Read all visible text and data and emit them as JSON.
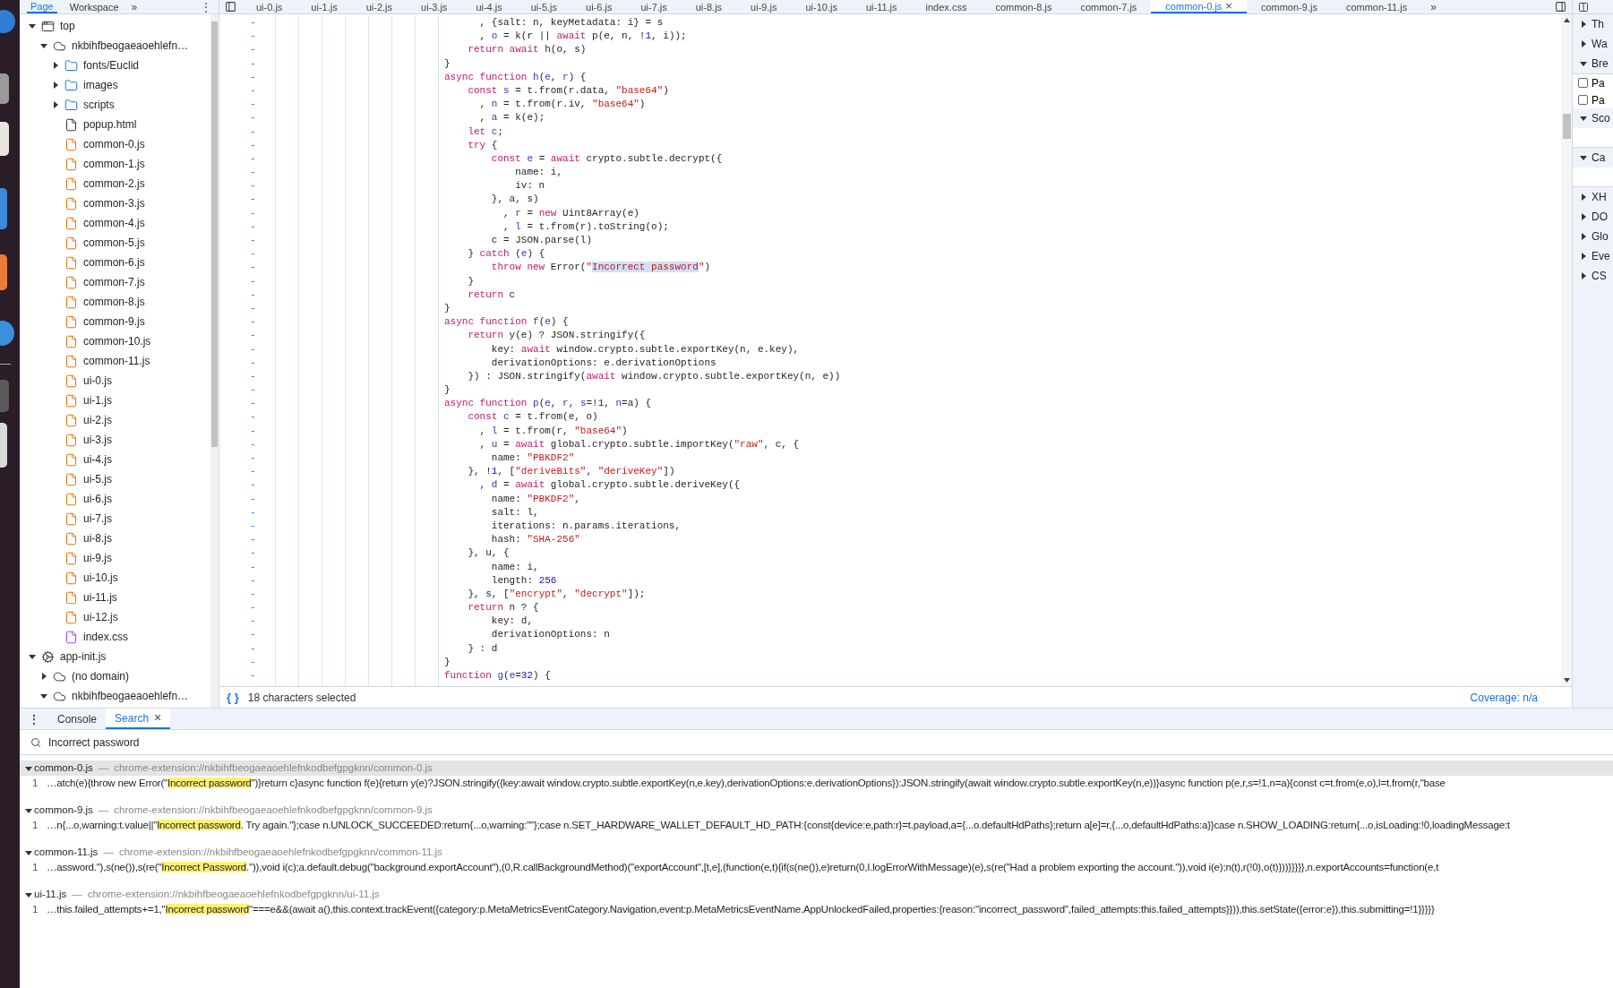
{
  "navigator_header": {
    "tabs": [
      {
        "label": "Page",
        "selected": true
      },
      {
        "label": "Workspace",
        "selected": false
      }
    ],
    "more": "»",
    "menu": "⋮"
  },
  "editor_tabs": {
    "tabs": [
      {
        "label": "ui-0.js",
        "selected": false
      },
      {
        "label": "ui-1.js",
        "selected": false
      },
      {
        "label": "ui-2.js",
        "selected": false
      },
      {
        "label": "ui-3.js",
        "selected": false
      },
      {
        "label": "ui-4.js",
        "selected": false
      },
      {
        "label": "ui-5.js",
        "selected": false
      },
      {
        "label": "ui-6.js",
        "selected": false
      },
      {
        "label": "ui-7.js",
        "selected": false
      },
      {
        "label": "ui-8.js",
        "selected": false
      },
      {
        "label": "ui-9.js",
        "selected": false
      },
      {
        "label": "ui-10.js",
        "selected": false
      },
      {
        "label": "ui-11.js",
        "selected": false
      },
      {
        "label": "index.css",
        "selected": false
      },
      {
        "label": "common-8.js",
        "selected": false
      },
      {
        "label": "common-7.js",
        "selected": false
      },
      {
        "label": "common-0.js",
        "selected": true,
        "close": "×"
      },
      {
        "label": "common-9.js",
        "selected": false
      },
      {
        "label": "common-11.js",
        "selected": false
      }
    ],
    "more": "»"
  },
  "navigator": {
    "tree": [
      {
        "label": "top",
        "kind": "frame",
        "expanded": true,
        "children": [
          {
            "label": "nkbihfbeogaeaoehlefn…",
            "kind": "cloud",
            "expanded": true,
            "children": [
              {
                "label": "fonts/Euclid",
                "kind": "folder",
                "expanded": false
              },
              {
                "label": "images",
                "kind": "folder",
                "expanded": false
              },
              {
                "label": "scripts",
                "kind": "folder",
                "expanded": false
              },
              {
                "label": "popup.html",
                "kind": "html"
              },
              {
                "label": "common-0.js",
                "kind": "js"
              },
              {
                "label": "common-1.js",
                "kind": "js"
              },
              {
                "label": "common-2.js",
                "kind": "js"
              },
              {
                "label": "common-3.js",
                "kind": "js"
              },
              {
                "label": "common-4.js",
                "kind": "js"
              },
              {
                "label": "common-5.js",
                "kind": "js"
              },
              {
                "label": "common-6.js",
                "kind": "js"
              },
              {
                "label": "common-7.js",
                "kind": "js"
              },
              {
                "label": "common-8.js",
                "kind": "js"
              },
              {
                "label": "common-9.js",
                "kind": "js"
              },
              {
                "label": "common-10.js",
                "kind": "js"
              },
              {
                "label": "common-11.js",
                "kind": "js"
              },
              {
                "label": "ui-0.js",
                "kind": "js"
              },
              {
                "label": "ui-1.js",
                "kind": "js"
              },
              {
                "label": "ui-2.js",
                "kind": "js"
              },
              {
                "label": "ui-3.js",
                "kind": "js"
              },
              {
                "label": "ui-4.js",
                "kind": "js"
              },
              {
                "label": "ui-5.js",
                "kind": "js"
              },
              {
                "label": "ui-6.js",
                "kind": "js"
              },
              {
                "label": "ui-7.js",
                "kind": "js"
              },
              {
                "label": "ui-8.js",
                "kind": "js"
              },
              {
                "label": "ui-9.js",
                "kind": "js"
              },
              {
                "label": "ui-10.js",
                "kind": "js"
              },
              {
                "label": "ui-11.js",
                "kind": "js"
              },
              {
                "label": "ui-12.js",
                "kind": "js"
              },
              {
                "label": "index.css",
                "kind": "css"
              }
            ]
          }
        ]
      },
      {
        "label": "app-init.js",
        "kind": "worker",
        "expanded": true,
        "children": [
          {
            "label": "(no domain)",
            "kind": "cloud",
            "expanded": false
          },
          {
            "label": "nkbihfbeogaeaoehlefn…",
            "kind": "cloud",
            "expanded": true
          }
        ]
      }
    ]
  },
  "editor": {
    "lines": [
      {
        "gutter": "-",
        "tokens": [
          {
            "text": "      , {salt: n, keyMetadata: i} = s",
            "kind": "plain"
          }
        ]
      },
      {
        "gutter": "-",
        "tokens": [
          {
            "text": "      , ",
            "kind": "plain"
          },
          {
            "text": "o",
            "kind": "def"
          },
          {
            "text": " = k(r || ",
            "kind": "plain"
          },
          {
            "text": "await",
            "kind": "keyword"
          },
          {
            "text": " p(e, n, !",
            "kind": "plain"
          },
          {
            "text": "1",
            "kind": "number"
          },
          {
            "text": ", i));",
            "kind": "plain"
          }
        ]
      },
      {
        "gutter": "-",
        "tokens": [
          {
            "text": "    return await",
            "kind": "keyword"
          },
          {
            "text": " h(o, s)",
            "kind": "plain"
          }
        ]
      },
      {
        "gutter": "-",
        "tokens": [
          {
            "text": "}",
            "kind": "plain"
          }
        ]
      },
      {
        "gutter": "-",
        "tokens": [
          {
            "text": "async function ",
            "kind": "keyword"
          },
          {
            "text": "h",
            "kind": "def"
          },
          {
            "text": "(",
            "kind": "plain"
          },
          {
            "text": "e",
            "kind": "def"
          },
          {
            "text": ", ",
            "kind": "plain"
          },
          {
            "text": "r",
            "kind": "def"
          },
          {
            "text": ") {",
            "kind": "plain"
          }
        ]
      },
      {
        "gutter": "-",
        "tokens": [
          {
            "text": "    const ",
            "kind": "keyword"
          },
          {
            "text": "s",
            "kind": "def"
          },
          {
            "text": " = t.from(r.data, ",
            "kind": "plain"
          },
          {
            "text": "\"base64\"",
            "kind": "string"
          },
          {
            "text": ")",
            "kind": "plain"
          }
        ]
      },
      {
        "gutter": "-",
        "tokens": [
          {
            "text": "      , ",
            "kind": "plain"
          },
          {
            "text": "n",
            "kind": "def"
          },
          {
            "text": " = t.from(r.iv, ",
            "kind": "plain"
          },
          {
            "text": "\"base64\"",
            "kind": "string"
          },
          {
            "text": ")",
            "kind": "plain"
          }
        ]
      },
      {
        "gutter": "-",
        "tokens": [
          {
            "text": "      , ",
            "kind": "plain"
          },
          {
            "text": "a",
            "kind": "def"
          },
          {
            "text": " = k(e);",
            "kind": "plain"
          }
        ]
      },
      {
        "gutter": "-",
        "tokens": [
          {
            "text": "    let ",
            "kind": "keyword"
          },
          {
            "text": "c",
            "kind": "def"
          },
          {
            "text": ";",
            "kind": "plain"
          }
        ]
      },
      {
        "gutter": "-",
        "tokens": [
          {
            "text": "    try",
            "kind": "keyword"
          },
          {
            "text": " {",
            "kind": "plain"
          }
        ]
      },
      {
        "gutter": "-",
        "tokens": [
          {
            "text": "        const ",
            "kind": "keyword"
          },
          {
            "text": "e",
            "kind": "def"
          },
          {
            "text": " = ",
            "kind": "plain"
          },
          {
            "text": "await",
            "kind": "keyword"
          },
          {
            "text": " crypto.subtle.decrypt({",
            "kind": "plain"
          }
        ]
      },
      {
        "gutter": "-",
        "tokens": [
          {
            "text": "            name: i,",
            "kind": "plain"
          }
        ]
      },
      {
        "gutter": "-",
        "tokens": [
          {
            "text": "            iv: n",
            "kind": "plain"
          }
        ]
      },
      {
        "gutter": "-",
        "tokens": [
          {
            "text": "        }, a, s)",
            "kind": "plain"
          }
        ]
      },
      {
        "gutter": "-",
        "tokens": [
          {
            "text": "          , ",
            "kind": "plain"
          },
          {
            "text": "r",
            "kind": "def"
          },
          {
            "text": " = ",
            "kind": "plain"
          },
          {
            "text": "new",
            "kind": "keyword"
          },
          {
            "text": " Uint8Array(e)",
            "kind": "plain"
          }
        ]
      },
      {
        "gutter": "-",
        "tokens": [
          {
            "text": "          , ",
            "kind": "plain"
          },
          {
            "text": "l",
            "kind": "def"
          },
          {
            "text": " = t.from(r).toString(o);",
            "kind": "plain"
          }
        ]
      },
      {
        "gutter": "-",
        "tokens": [
          {
            "text": "        c = JSON.parse(l)",
            "kind": "plain"
          }
        ]
      },
      {
        "gutter": "-",
        "tokens": [
          {
            "text": "    } ",
            "kind": "plain"
          },
          {
            "text": "catch",
            "kind": "keyword"
          },
          {
            "text": " (",
            "kind": "plain"
          },
          {
            "text": "e",
            "kind": "def"
          },
          {
            "text": ") {",
            "kind": "plain"
          }
        ]
      },
      {
        "gutter": "-",
        "tokens": [
          {
            "text": "        throw new",
            "kind": "keyword"
          },
          {
            "text": " Error(",
            "kind": "plain"
          },
          {
            "text": "\"",
            "kind": "string"
          },
          {
            "text": "Incorrect password",
            "kind": "selection"
          },
          {
            "text": "\"",
            "kind": "string"
          },
          {
            "text": ")",
            "kind": "plain"
          }
        ]
      },
      {
        "gutter": "-",
        "tokens": [
          {
            "text": "    }",
            "kind": "plain"
          }
        ]
      },
      {
        "gutter": "-",
        "tokens": [
          {
            "text": "    return",
            "kind": "keyword"
          },
          {
            "text": " c",
            "kind": "plain"
          }
        ]
      },
      {
        "gutter": "-",
        "tokens": [
          {
            "text": "}",
            "kind": "plain"
          }
        ]
      },
      {
        "gutter": "-",
        "tokens": [
          {
            "text": "async function ",
            "kind": "keyword"
          },
          {
            "text": "f",
            "kind": "def"
          },
          {
            "text": "(",
            "kind": "plain"
          },
          {
            "text": "e",
            "kind": "def"
          },
          {
            "text": ") {",
            "kind": "plain"
          }
        ]
      },
      {
        "gutter": "-",
        "tokens": [
          {
            "text": "    return",
            "kind": "keyword"
          },
          {
            "text": " y(e) ? JSON.stringify({",
            "kind": "plain"
          }
        ]
      },
      {
        "gutter": "-",
        "tokens": [
          {
            "text": "        key: ",
            "kind": "plain"
          },
          {
            "text": "await",
            "kind": "keyword"
          },
          {
            "text": " window.crypto.subtle.exportKey(n, e.key),",
            "kind": "plain"
          }
        ]
      },
      {
        "gutter": "-",
        "tokens": [
          {
            "text": "        derivationOptions: e.derivationOptions",
            "kind": "plain"
          }
        ]
      },
      {
        "gutter": "-",
        "tokens": [
          {
            "text": "    }) : JSON.stringify(",
            "kind": "plain"
          },
          {
            "text": "await",
            "kind": "keyword"
          },
          {
            "text": " window.crypto.subtle.exportKey(n, e))",
            "kind": "plain"
          }
        ]
      },
      {
        "gutter": "-",
        "tokens": [
          {
            "text": "}",
            "kind": "plain"
          }
        ]
      },
      {
        "gutter": "-",
        "tokens": [
          {
            "text": "async function ",
            "kind": "keyword"
          },
          {
            "text": "p",
            "kind": "def"
          },
          {
            "text": "(",
            "kind": "plain"
          },
          {
            "text": "e",
            "kind": "def"
          },
          {
            "text": ", ",
            "kind": "plain"
          },
          {
            "text": "r",
            "kind": "def"
          },
          {
            "text": ", ",
            "kind": "plain"
          },
          {
            "text": "s",
            "kind": "def"
          },
          {
            "text": "=!",
            "kind": "plain"
          },
          {
            "text": "1",
            "kind": "number"
          },
          {
            "text": ", ",
            "kind": "plain"
          },
          {
            "text": "n",
            "kind": "def"
          },
          {
            "text": "=a) {",
            "kind": "plain"
          }
        ]
      },
      {
        "gutter": "-",
        "tokens": [
          {
            "text": "    const ",
            "kind": "keyword"
          },
          {
            "text": "c",
            "kind": "def"
          },
          {
            "text": " = t.from(e, o)",
            "kind": "plain"
          }
        ]
      },
      {
        "gutter": "-",
        "tokens": [
          {
            "text": "      , ",
            "kind": "plain"
          },
          {
            "text": "l",
            "kind": "def"
          },
          {
            "text": " = t.from(r, ",
            "kind": "plain"
          },
          {
            "text": "\"base64\"",
            "kind": "string"
          },
          {
            "text": ")",
            "kind": "plain"
          }
        ]
      },
      {
        "gutter": "-",
        "tokens": [
          {
            "text": "      , ",
            "kind": "plain"
          },
          {
            "text": "u",
            "kind": "def"
          },
          {
            "text": " = ",
            "kind": "plain"
          },
          {
            "text": "await",
            "kind": "keyword"
          },
          {
            "text": " global.crypto.subtle.importKey(",
            "kind": "plain"
          },
          {
            "text": "\"raw\"",
            "kind": "string"
          },
          {
            "text": ", c, {",
            "kind": "plain"
          }
        ]
      },
      {
        "gutter": "-",
        "tokens": [
          {
            "text": "        name: ",
            "kind": "plain"
          },
          {
            "text": "\"PBKDF2\"",
            "kind": "string"
          }
        ]
      },
      {
        "gutter": "-",
        "tokens": [
          {
            "text": "    }, !",
            "kind": "plain"
          },
          {
            "text": "1",
            "kind": "number"
          },
          {
            "text": ", [",
            "kind": "plain"
          },
          {
            "text": "\"deriveBits\"",
            "kind": "string"
          },
          {
            "text": ", ",
            "kind": "plain"
          },
          {
            "text": "\"deriveKey\"",
            "kind": "string"
          },
          {
            "text": "])",
            "kind": "plain"
          }
        ]
      },
      {
        "gutter": "-",
        "tokens": [
          {
            "text": "      , ",
            "kind": "plain"
          },
          {
            "text": "d",
            "kind": "def"
          },
          {
            "text": " = ",
            "kind": "plain"
          },
          {
            "text": "await",
            "kind": "keyword"
          },
          {
            "text": " global.crypto.subtle.deriveKey({",
            "kind": "plain"
          }
        ]
      },
      {
        "gutter": "-",
        "tokens": [
          {
            "text": "        name: ",
            "kind": "plain"
          },
          {
            "text": "\"PBKDF2\"",
            "kind": "string"
          },
          {
            "text": ",",
            "kind": "plain"
          }
        ]
      },
      {
        "gutter": "-",
        "tokens": [
          {
            "text": "        salt: l,",
            "kind": "plain"
          }
        ]
      },
      {
        "gutter": "-",
        "tokens": [
          {
            "text": "        iterations: n.params.iterations,",
            "kind": "plain"
          }
        ]
      },
      {
        "gutter": "-",
        "tokens": [
          {
            "text": "        hash: ",
            "kind": "plain"
          },
          {
            "text": "\"SHA-256\"",
            "kind": "string"
          }
        ]
      },
      {
        "gutter": "-",
        "tokens": [
          {
            "text": "    }, u, {",
            "kind": "plain"
          }
        ]
      },
      {
        "gutter": "-",
        "tokens": [
          {
            "text": "        name: i,",
            "kind": "plain"
          }
        ]
      },
      {
        "gutter": "-",
        "tokens": [
          {
            "text": "        length: ",
            "kind": "plain"
          },
          {
            "text": "256",
            "kind": "number"
          }
        ]
      },
      {
        "gutter": "-",
        "tokens": [
          {
            "text": "    }, s, [",
            "kind": "plain"
          },
          {
            "text": "\"encrypt\"",
            "kind": "string"
          },
          {
            "text": ", ",
            "kind": "plain"
          },
          {
            "text": "\"decrypt\"",
            "kind": "string"
          },
          {
            "text": "]);",
            "kind": "plain"
          }
        ]
      },
      {
        "gutter": "-",
        "tokens": [
          {
            "text": "    return",
            "kind": "keyword"
          },
          {
            "text": " n ? {",
            "kind": "plain"
          }
        ]
      },
      {
        "gutter": "-",
        "tokens": [
          {
            "text": "        key: d,",
            "kind": "plain"
          }
        ]
      },
      {
        "gutter": "-",
        "tokens": [
          {
            "text": "        derivationOptions: n",
            "kind": "plain"
          }
        ]
      },
      {
        "gutter": "-",
        "tokens": [
          {
            "text": "    } : d",
            "kind": "plain"
          }
        ]
      },
      {
        "gutter": "-",
        "tokens": [
          {
            "text": "}",
            "kind": "plain"
          }
        ]
      },
      {
        "gutter": "-",
        "tokens": [
          {
            "text": "function ",
            "kind": "keyword"
          },
          {
            "text": "g",
            "kind": "def"
          },
          {
            "text": "(",
            "kind": "plain"
          },
          {
            "text": "e",
            "kind": "def"
          },
          {
            "text": "=",
            "kind": "plain"
          },
          {
            "text": "32",
            "kind": "number"
          },
          {
            "text": ") {",
            "kind": "plain"
          }
        ]
      }
    ]
  },
  "status_bar": {
    "format_button": "{ }",
    "selection": "18 characters selected",
    "coverage": "Coverage: n/a"
  },
  "right_panel": {
    "items": [
      {
        "kind": "section",
        "label": "Th",
        "expanded": false
      },
      {
        "kind": "section",
        "label": "Wa",
        "expanded": false
      },
      {
        "kind": "section",
        "label": "Bre",
        "expanded": true
      },
      {
        "kind": "checkbox",
        "label": "Pa",
        "checked": false
      },
      {
        "kind": "checkbox",
        "label": "Pa",
        "checked": false
      },
      {
        "kind": "section",
        "label": "Sco",
        "expanded": true
      },
      {
        "kind": "section",
        "label": "Ca",
        "expanded": true
      },
      {
        "kind": "section",
        "label": "XH",
        "expanded": false
      },
      {
        "kind": "section",
        "label": "DO",
        "expanded": false
      },
      {
        "kind": "section",
        "label": "Glo",
        "expanded": false
      },
      {
        "kind": "section",
        "label": "Eve",
        "expanded": false
      },
      {
        "kind": "section",
        "label": "CS",
        "expanded": false
      }
    ]
  },
  "drawer": {
    "menu": "⋮",
    "tabs": [
      {
        "label": "Console",
        "selected": false
      },
      {
        "label": "Search",
        "selected": true,
        "close": "×"
      }
    ],
    "search": {
      "value": "Incorrect password"
    },
    "results": [
      {
        "file": "common-0.js",
        "separator": "—",
        "url": "chrome-extension://nkbihfbeogaeaoehlefnkodbefgpgknn/common-0.js",
        "expanded": true,
        "selected": true,
        "matches": [
          {
            "line": "1",
            "before": "…atch(e){throw new Error(\"",
            "match": "Incorrect password",
            "after": "\")}return c}async function f(e){return y(e)?JSON.stringify({key:await window.crypto.subtle.exportKey(n,e.key),derivationOptions:e.derivationOptions}):JSON.stringify(await window.crypto.subtle.exportKey(n,e))}async function p(e,r,s=!1,n=a){const c=t.from(e,o),l=t.from(r,\"base"
          }
        ]
      },
      {
        "file": "common-9.js",
        "separator": "—",
        "url": "chrome-extension://nkbihfbeogaeaoehlefnkodbefgpgknn/common-9.js",
        "expanded": true,
        "selected": false,
        "matches": [
          {
            "line": "1",
            "before": "…n{...o,warning:t.value||\"",
            "match": "Incorrect password",
            "after": ". Try again.\"};case n.UNLOCK_SUCCEEDED:return{...o,warning:\"\"};case n.SET_HARDWARE_WALLET_DEFAULT_HD_PATH:{const{device:e,path:r}=t.payload,a={...o.defaultHdPaths};return a[e]=r,{...o,defaultHdPaths:a}}case n.SHOW_LOADING:return{...o,isLoading:!0,loadingMessage:t"
          }
        ]
      },
      {
        "file": "common-11.js",
        "separator": "—",
        "url": "chrome-extension://nkbihfbeogaeaoehlefnkodbefgpgknn/common-11.js",
        "expanded": true,
        "selected": false,
        "matches": [
          {
            "line": "1",
            "before": "…assword.\"),s(ne()),s(re(\"",
            "match": "Incorrect Password",
            "after": ".\")),void i(c);a.default.debug(\"background.exportAccount\"),(0,R.callBackgroundMethod)(\"exportAccount\",[t,e],(function(e,t){if(s(ne()),e)return(0,I.logErrorWithMessage)(e),s(re(\"Had a problem exporting the account.\")),void i(e);n(t),r(!0),o(t)}))}}}}},n.exportAccounts=function(e,t"
          }
        ]
      },
      {
        "file": "ui-11.js",
        "separator": "—",
        "url": "chrome-extension://nkbihfbeogaeaoehlefnkodbefgpgknn/ui-11.js",
        "expanded": true,
        "selected": false,
        "matches": [
          {
            "line": "1",
            "before": "…this.failed_attempts+=1,\"",
            "match": "Incorrect password",
            "after": "\"===e&&(await a(),this.context.trackEvent({category:p.MetaMetricsEventCategory.Navigation,event:p.MetaMetricsEventName.AppUnlockedFailed,properties:{reason:\"incorrect_password\",failed_attempts:this.failed_attempts}})),this.setState({error:e}),this.submitting=!1}}}}}"
          }
        ]
      }
    ]
  }
}
